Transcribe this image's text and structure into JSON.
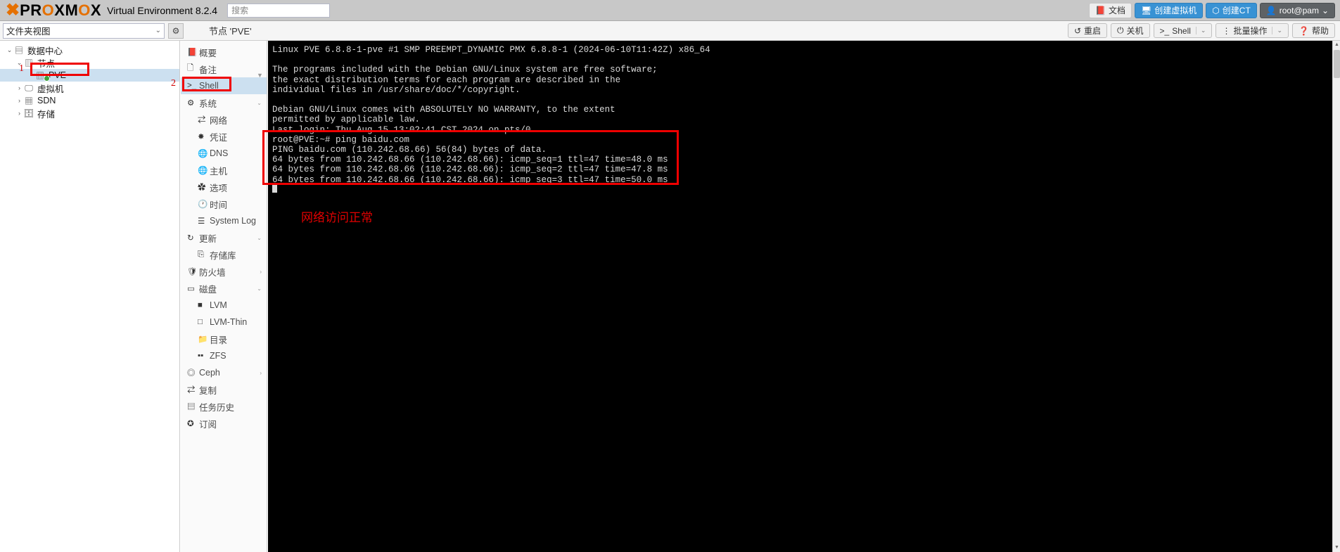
{
  "header": {
    "logo_x": "X",
    "logo_pro": "PRO",
    "logo_o1": "X",
    "logo_m": "M",
    "logo_o2": "O",
    "logo_x2": "X",
    "brand_full": "PROXMOX",
    "product": "Virtual Environment 8.2.4",
    "search_placeholder": "搜索",
    "buttons": [
      {
        "label": "文档",
        "icon": "book-icon",
        "style": "light"
      },
      {
        "label": "创建虚拟机",
        "icon": "monitor-icon",
        "style": "blue"
      },
      {
        "label": "创建CT",
        "icon": "container-icon",
        "style": "blue"
      },
      {
        "label": "root@pam",
        "icon": "user-icon",
        "style": "dark",
        "chevron": "⌄"
      }
    ]
  },
  "secondbar": {
    "view_select": "文件夹视图",
    "view_chevron": "⌄",
    "gear_icon": "gear-icon",
    "node_title": "节点 'PVE'",
    "buttons": [
      {
        "label": "重启",
        "icon": "restart-icon",
        "split": ""
      },
      {
        "label": "关机",
        "icon": "power-icon",
        "split": ""
      },
      {
        "label": "Shell",
        "icon": "shell-prompt-icon",
        "split": "⌄"
      },
      {
        "label": "批量操作",
        "icon": "dots-vertical-icon",
        "split": "⌄"
      },
      {
        "label": "帮助",
        "icon": "help-icon",
        "split": ""
      }
    ]
  },
  "tree": {
    "nodes": [
      {
        "label": "数据中心",
        "level": 1,
        "expander": "⌄",
        "icon": "datacenter-icon",
        "selected": false
      },
      {
        "label": "节点",
        "level": 2,
        "expander": "⌄",
        "icon": "node-icon",
        "selected": false
      },
      {
        "label": "PVE",
        "level": 3,
        "expander": "",
        "icon": "server-icon",
        "selected": true,
        "status": "online"
      },
      {
        "label": "虚拟机",
        "level": 2,
        "expander": "›",
        "icon": "vm-icon",
        "selected": false
      },
      {
        "label": "SDN",
        "level": 2,
        "expander": "›",
        "icon": "sdn-icon",
        "selected": false
      },
      {
        "label": "存储",
        "level": 2,
        "expander": "›",
        "icon": "storage-icon",
        "selected": false
      }
    ],
    "marker": "1"
  },
  "menu": {
    "marker": "2",
    "items": [
      {
        "label": "概要",
        "icon": "book-icon",
        "sub": false,
        "active": false,
        "arrow": ""
      },
      {
        "label": "备注",
        "icon": "note-icon",
        "sub": false,
        "active": false,
        "arrow": ""
      },
      {
        "label": "Shell",
        "icon": "shell-prompt-icon",
        "sub": false,
        "active": true,
        "arrow": ""
      },
      {
        "label": "系统",
        "icon": "system-gears-icon",
        "sub": false,
        "active": false,
        "arrow": "⌄"
      },
      {
        "label": "网络",
        "icon": "network-icon",
        "sub": true,
        "active": false,
        "arrow": ""
      },
      {
        "label": "凭证",
        "icon": "certificate-icon",
        "sub": true,
        "active": false,
        "arrow": ""
      },
      {
        "label": "DNS",
        "icon": "globe-icon",
        "sub": true,
        "active": false,
        "arrow": ""
      },
      {
        "label": "主机",
        "icon": "globe-icon",
        "sub": true,
        "active": false,
        "arrow": ""
      },
      {
        "label": "选项",
        "icon": "gear-icon",
        "sub": true,
        "active": false,
        "arrow": ""
      },
      {
        "label": "时间",
        "icon": "clock-icon",
        "sub": true,
        "active": false,
        "arrow": ""
      },
      {
        "label": "System Log",
        "icon": "list-icon",
        "sub": true,
        "active": false,
        "arrow": ""
      },
      {
        "label": "更新",
        "icon": "refresh-icon",
        "sub": false,
        "active": false,
        "arrow": "⌄"
      },
      {
        "label": "存储库",
        "icon": "repository-icon",
        "sub": true,
        "active": false,
        "arrow": ""
      },
      {
        "label": "防火墙",
        "icon": "shield-icon",
        "sub": false,
        "active": false,
        "arrow": "›"
      },
      {
        "label": "磁盘",
        "icon": "disk-icon",
        "sub": false,
        "active": false,
        "arrow": "⌄"
      },
      {
        "label": "LVM",
        "icon": "lvm-icon",
        "sub": true,
        "active": false,
        "arrow": ""
      },
      {
        "label": "LVM-Thin",
        "icon": "lvm-thin-icon",
        "sub": true,
        "active": false,
        "arrow": ""
      },
      {
        "label": "目录",
        "icon": "folder-icon",
        "sub": true,
        "active": false,
        "arrow": ""
      },
      {
        "label": "ZFS",
        "icon": "zfs-icon",
        "sub": true,
        "active": false,
        "arrow": ""
      },
      {
        "label": "Ceph",
        "icon": "ceph-icon",
        "sub": false,
        "active": false,
        "arrow": "›"
      },
      {
        "label": "复制",
        "icon": "replication-icon",
        "sub": false,
        "active": false,
        "arrow": ""
      },
      {
        "label": "任务历史",
        "icon": "task-history-icon",
        "sub": false,
        "active": false,
        "arrow": ""
      },
      {
        "label": "订阅",
        "icon": "subscription-icon",
        "sub": false,
        "active": false,
        "arrow": ""
      }
    ]
  },
  "terminal": {
    "lines": [
      "Linux PVE 6.8.8-1-pve #1 SMP PREEMPT_DYNAMIC PMX 6.8.8-1 (2024-06-10T11:42Z) x86_64",
      "",
      "The programs included with the Debian GNU/Linux system are free software;",
      "the exact distribution terms for each program are described in the",
      "individual files in /usr/share/doc/*/copyright.",
      "",
      "Debian GNU/Linux comes with ABSOLUTELY NO WARRANTY, to the extent",
      "permitted by applicable law.",
      "Last login: Thu Aug 15 13:02:41 CST 2024 on pts/0",
      "root@PVE:~# ping baidu.com",
      "PING baidu.com (110.242.68.66) 56(84) bytes of data.",
      "64 bytes from 110.242.68.66 (110.242.68.66): icmp_seq=1 ttl=47 time=48.0 ms",
      "64 bytes from 110.242.68.66 (110.242.68.66): icmp_seq=2 ttl=47 time=47.8 ms",
      "64 bytes from 110.242.68.66 (110.242.68.66): icmp_seq=3 ttl=47 time=50.0 ms"
    ]
  },
  "annotations": {
    "note": "网络访问正常",
    "color": "#e30000"
  },
  "scrollbar": {
    "up": "▲",
    "down": "▼"
  }
}
